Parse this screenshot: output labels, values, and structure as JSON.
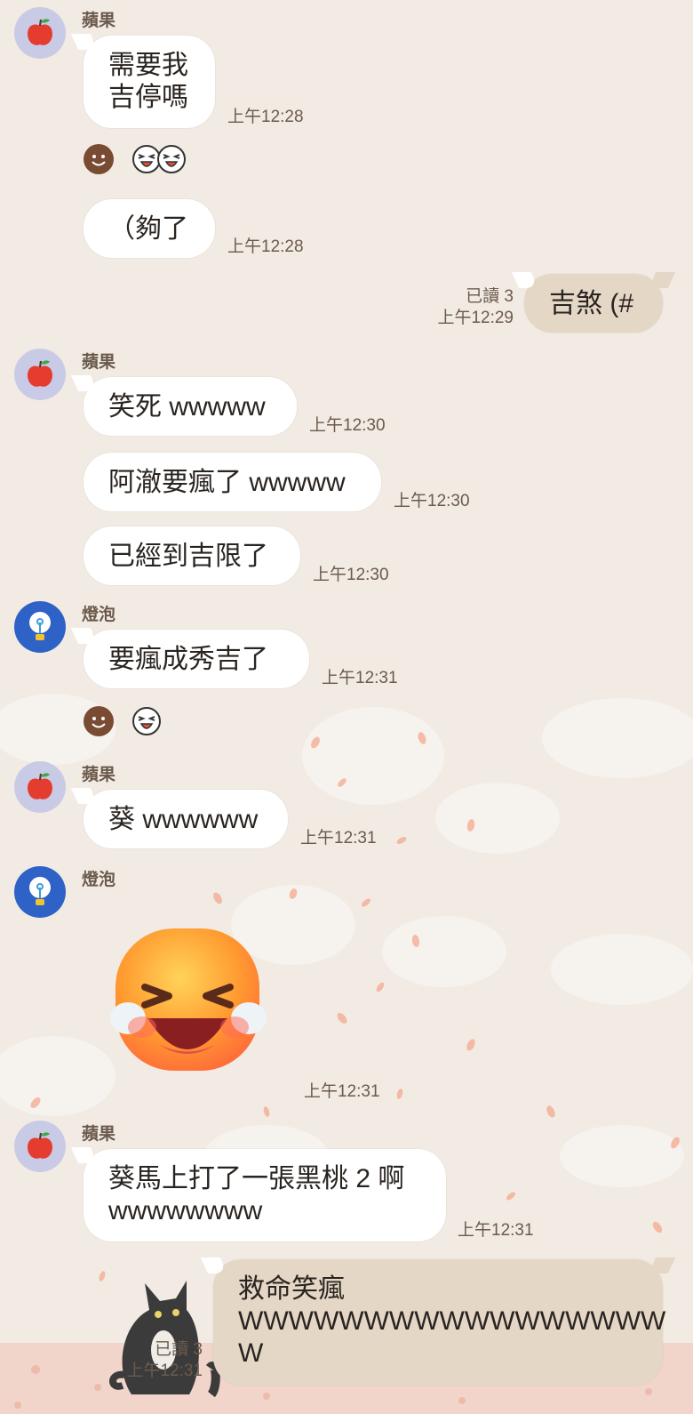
{
  "chat": {
    "read_label": "已讀 3",
    "messages": [
      {
        "sender": "蘋果",
        "text": "需要我\n吉停嗎",
        "time": "上午12:28"
      },
      {
        "text": "（夠了",
        "time": "上午12:28"
      },
      {
        "mine": true,
        "text": "吉煞 (#",
        "time": "上午12:29",
        "read": "已讀 3"
      },
      {
        "sender": "蘋果",
        "text": "笑死 wwwww",
        "time": "上午12:30"
      },
      {
        "text": "阿澈要瘋了 wwwww",
        "time": "上午12:30"
      },
      {
        "text": "已經到吉限了",
        "time": "上午12:30"
      },
      {
        "sender": "燈泡",
        "text": "要瘋成秀吉了",
        "time": "上午12:31"
      },
      {
        "sender": "蘋果",
        "text": "葵 wwwwww",
        "time": "上午12:31"
      },
      {
        "sender": "燈泡",
        "sticker": "laughing-crying-face",
        "time": "上午12:31"
      },
      {
        "sender": "蘋果",
        "text": "葵馬上打了一張黑桃 2 啊\nwwwwwwww",
        "time": "上午12:31"
      },
      {
        "mine": true,
        "text": "救命笑瘋\nWWWWWWWWWWWWWWWWW\nW",
        "time": "上午12:31",
        "read": "已讀 3"
      }
    ]
  },
  "senders": {
    "apple": "蘋果",
    "bulb": "燈泡"
  },
  "colors": {
    "background": "#f2ebe4",
    "my_bubble": "#e4d7c6",
    "other_bubble": "#ffffff",
    "meta_text": "#6b5a4c"
  }
}
